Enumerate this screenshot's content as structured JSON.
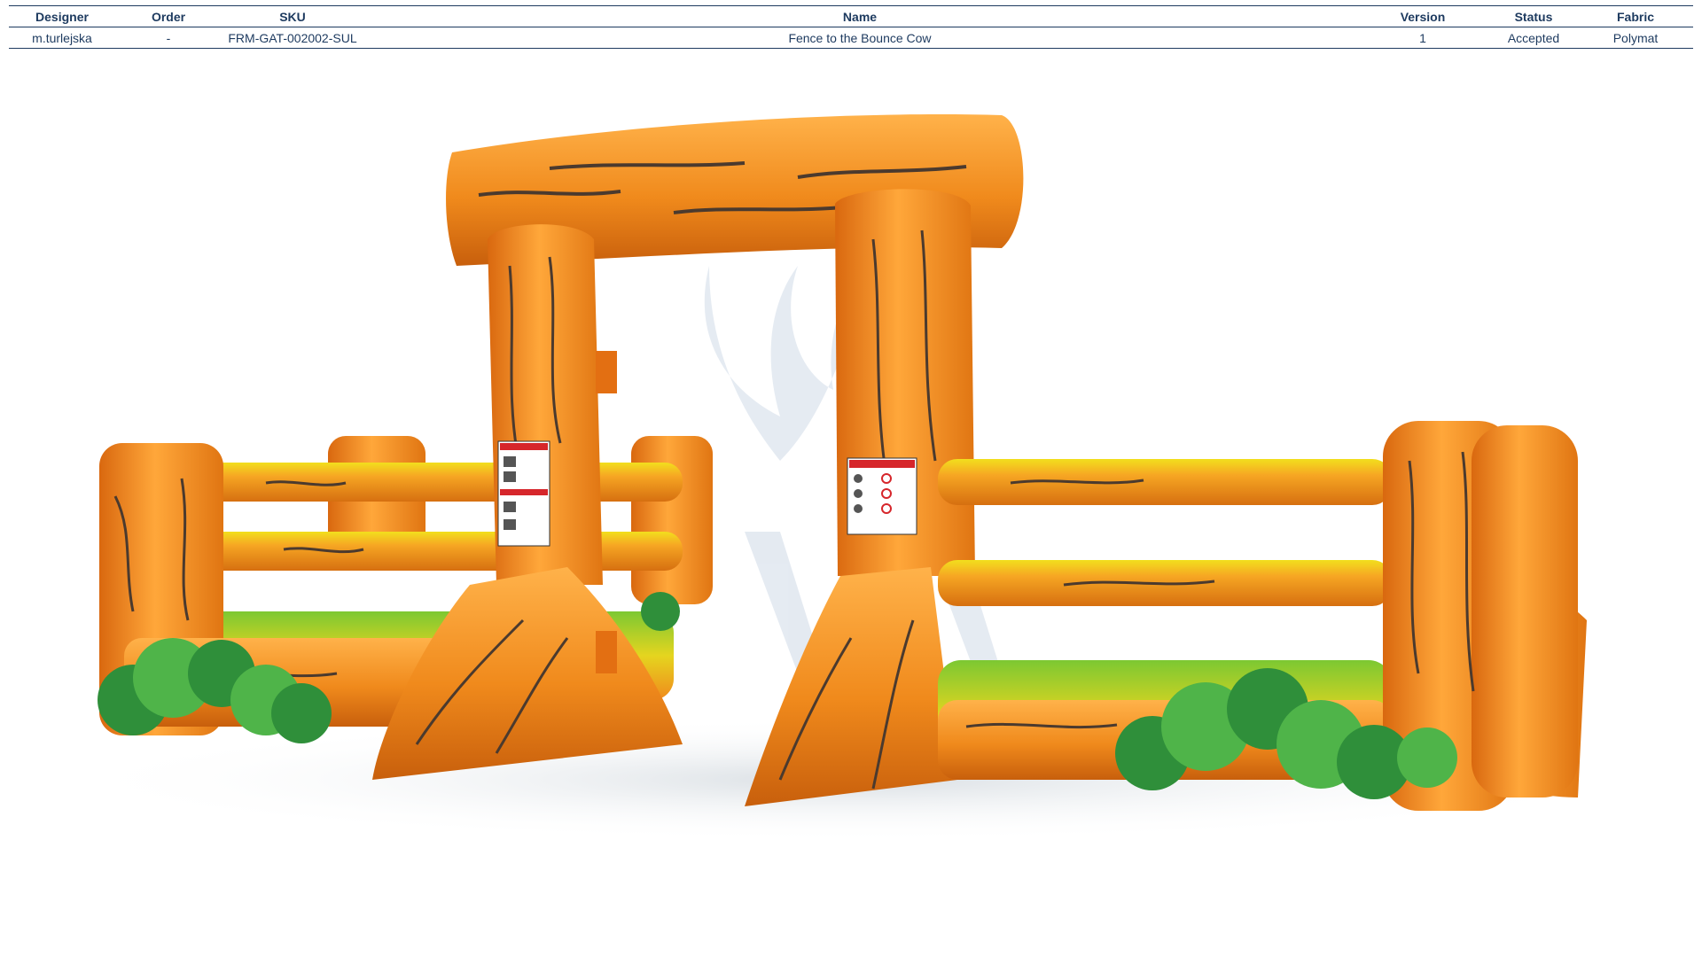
{
  "spec_header": {
    "designer": "Designer",
    "order": "Order",
    "sku": "SKU",
    "name": "Name",
    "version": "Version",
    "status": "Status",
    "fabric": "Fabric"
  },
  "spec_row": {
    "designer": "m.turlejska",
    "order": "-",
    "sku": "FRM-GAT-002002-SUL",
    "name": "Fence to the Bounce Cow",
    "version": "1",
    "status": "Accepted",
    "fabric": "Polymat"
  },
  "render": {
    "subject": "inflatable-fence-gate",
    "colors": {
      "wood": "#f08a1c",
      "wood_dark": "#c85f0c",
      "wood_light": "#ffb24a",
      "grain": "#4b3a2e",
      "rail_top": "#f2df1d",
      "grass": "#46ad3a",
      "bush": "#2f8f3a",
      "bush_light": "#4fb449",
      "label_red": "#d6262b"
    },
    "icons": [
      "danger-label-icon",
      "warning-label-icon",
      "watermark-logo-icon"
    ]
  }
}
